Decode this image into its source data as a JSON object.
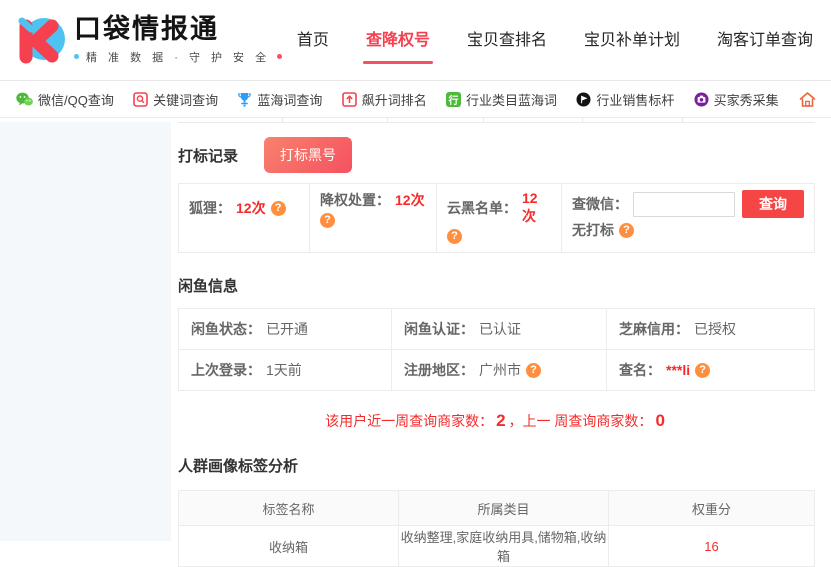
{
  "brand": {
    "name": "口袋情报通",
    "tagline": "精 准 数 据 · 守 护 安 全"
  },
  "top_nav": {
    "home": "首页",
    "check_demoted": "查降权号",
    "item_rank": "宝贝查排名",
    "supplement_plan": "宝贝补单计划",
    "taoke_orders": "淘客订单查询"
  },
  "tool_nav": {
    "wechat_qq": "微信/QQ查询",
    "keyword": "关键词查询",
    "blue_ocean": "蓝海词查询",
    "rising_words": "飙升词排名",
    "industry_blue_ocean": "行业类目蓝海词",
    "industry_benchmark": "行业销售标杆",
    "buyer_show": "买家秀采集",
    "industry_icon_char": "行"
  },
  "icons": {
    "help_glyph": "?"
  },
  "marking": {
    "title": "打标记录",
    "black_button": "打标黑号",
    "fox_label": "狐狸：",
    "fox_value": "12次",
    "demote_label": "降权处置：",
    "demote_value": "12次",
    "cloud_label": "云黑名单：",
    "cloud_value": "12次",
    "wechat_label": "查微信：",
    "wechat_input_value": "",
    "query_button": "查询",
    "no_mark_label": "无打标"
  },
  "xianyu": {
    "title": "闲鱼信息",
    "status_label": "闲鱼状态：",
    "status_value": "已开通",
    "auth_label": "闲鱼认证：",
    "auth_value": "已认证",
    "credit_label": "芝麻信用：",
    "credit_value": "已授权",
    "login_label": "上次登录：",
    "login_value": "1天前",
    "region_label": "注册地区：",
    "region_value": "广州市",
    "name_label": "查名：",
    "name_value": "***li"
  },
  "stats": {
    "this_week_label": "该用户近一周查询商家数：",
    "this_week_value": "2",
    "separator": "，",
    "last_week_label": "上一 周查询商家数：",
    "last_week_value": "0"
  },
  "tags": {
    "title": "人群画像标签分析",
    "headers": [
      "标签名称",
      "所属类目",
      "权重分"
    ],
    "rows": [
      [
        "收纳箱",
        "收纳整理,家庭收纳用具,储物箱,收纳箱",
        "16"
      ]
    ]
  },
  "colors": {
    "accent_red": "#f5515f",
    "red_text": "#f52b2b",
    "help_orange": "#ff8f3e",
    "sidebar_bg": "#f4f8fb"
  }
}
